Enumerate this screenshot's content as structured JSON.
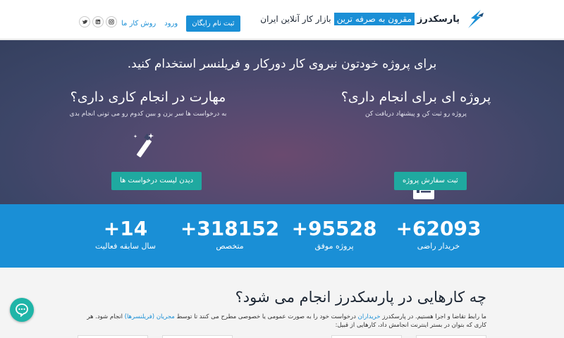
{
  "header": {
    "logo_name": "پارسکدرز",
    "logo_highlight": "مقرون به صرفه ترین",
    "logo_rest": "بازار کار آنلاین ایران",
    "signup_label": "ثبت نام رایگان",
    "login_label": "ورود",
    "how_label": "روش کار ما",
    "social": [
      "instagram-icon",
      "linkedin-icon",
      "twitter-icon"
    ]
  },
  "hero": {
    "tagline": "برای پروژه خودتون نیروی کار دورکار و فریلنسر استخدام کنید.",
    "project_title": "پروژه ای برای انجام داری؟",
    "project_text": "پروژه رو ثبت کن و پیشنهاد دریافت کن",
    "project_button": "ثبت سفارش پروژه",
    "skill_title": "مهارت در انجام کاری داری؟",
    "skill_text": "به درخواست ها سر بزن و ببین کدوم رو می تونی انجام بدی",
    "skill_button": "دیدن لیست درخواست ها"
  },
  "stats": [
    {
      "number": "+62093",
      "label": "خریدار راضی"
    },
    {
      "number": "+95528",
      "label": "پروژه موفق"
    },
    {
      "number": "+318152",
      "label": "متخصص"
    },
    {
      "number": "+14",
      "label": "سال سابقه فعالیت"
    }
  ],
  "section": {
    "title": "چه کارهایی در پارسکدرز انجام می شود؟",
    "text_part1": "ما رابط تقاضا و اجرا هستیم. در پارسکدرز ",
    "link1": "خریداران",
    "text_part2": " درخواست خود را به صورت عمومی یا خصوصی مطرح می کنند تا توسط ",
    "link2": "مجریان (فریلنسرها)",
    "text_part3": " انجام شود. هر کاری که بتوان در بستر اینترنت انجامش داد، کارهایی از قبیل:"
  },
  "colors": {
    "primary": "#1a8fd6",
    "teal": "#1fa9a0",
    "hero_bg": "#3d4668"
  }
}
